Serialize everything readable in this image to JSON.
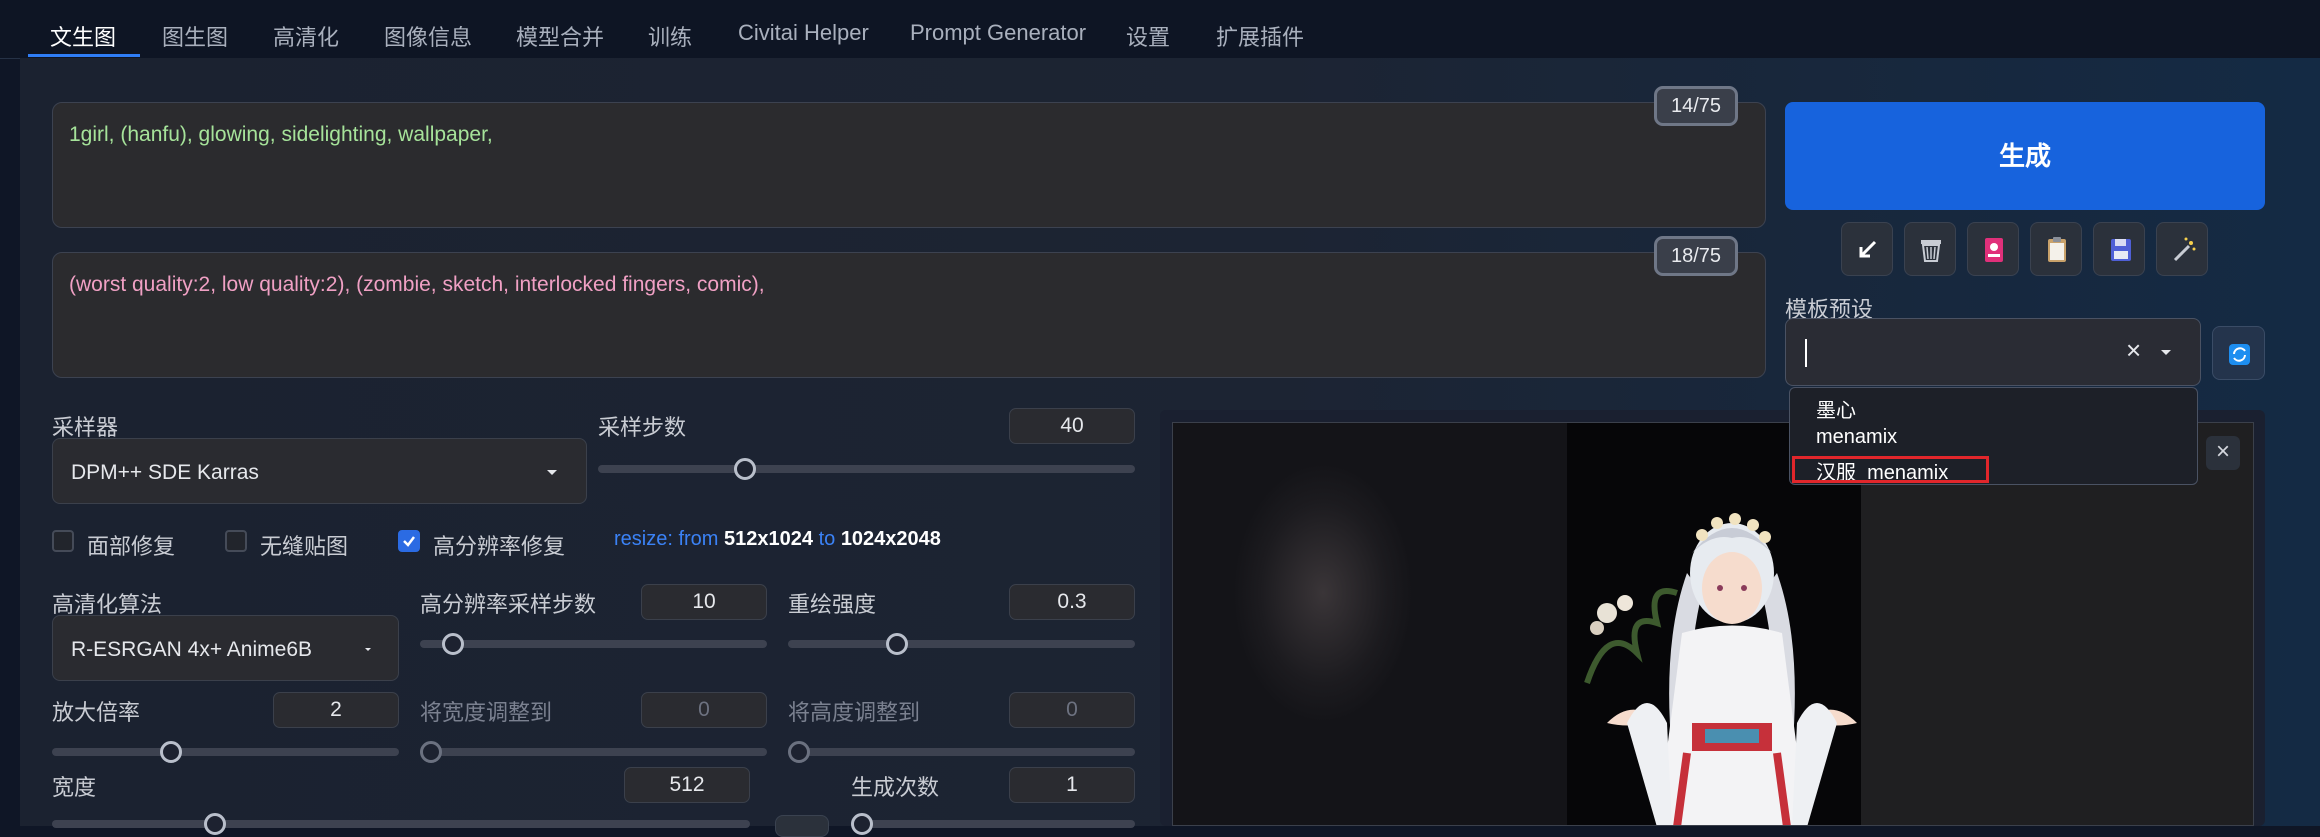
{
  "tabs": [
    "文生图",
    "图生图",
    "高清化",
    "图像信息",
    "模型合并",
    "训练",
    "Civitai Helper",
    "Prompt Generator",
    "设置",
    "扩展插件"
  ],
  "prompt": {
    "text": "1girl, (hanfu), glowing, sidelighting, wallpaper,",
    "counter": "14/75"
  },
  "negative_prompt": {
    "text": "(worst quality:2, low quality:2), (zombie, sketch, interlocked fingers, comic),",
    "counter": "18/75"
  },
  "generate_label": "生成",
  "toolbar_icons": [
    "arrow-icon",
    "trash-icon",
    "card-icon",
    "clipboard-icon",
    "save-icon",
    "magic-wand-icon"
  ],
  "sampler": {
    "label": "采样器",
    "value": "DPM++ SDE Karras"
  },
  "steps": {
    "label": "采样步数",
    "value": "40"
  },
  "checkboxes": [
    {
      "label": "面部修复",
      "checked": false
    },
    {
      "label": "无缝贴图",
      "checked": false
    },
    {
      "label": "高分辨率修复",
      "checked": true
    }
  ],
  "resize_info": {
    "prefix": "resize: from ",
    "from": "512x1024",
    "to_word": " to ",
    "to": "1024x2048"
  },
  "upscaler": {
    "label": "高清化算法",
    "value": "R-ESRGAN 4x+ Anime6B"
  },
  "hires_steps": {
    "label": "高分辨率采样步数",
    "value": "10"
  },
  "denoise": {
    "label": "重绘强度",
    "value": "0.3"
  },
  "upscale_by": {
    "label": "放大倍率",
    "value": "2"
  },
  "resize_width": {
    "label": "将宽度调整到",
    "value": "0"
  },
  "resize_height": {
    "label": "将高度调整到",
    "value": "0"
  },
  "width": {
    "label": "宽度",
    "value": "512"
  },
  "batch_count": {
    "label": "生成次数",
    "value": "1"
  },
  "presets": {
    "label": "模板预设",
    "clear": "×",
    "options": [
      "墨心",
      "menamix",
      "汉服_menamix"
    ]
  },
  "gallery_close": "×",
  "colors": {
    "accent": "#1763dd",
    "prompt": "#a6e39a",
    "negative": "#f0a0c4",
    "highlight": "#e1262b"
  }
}
